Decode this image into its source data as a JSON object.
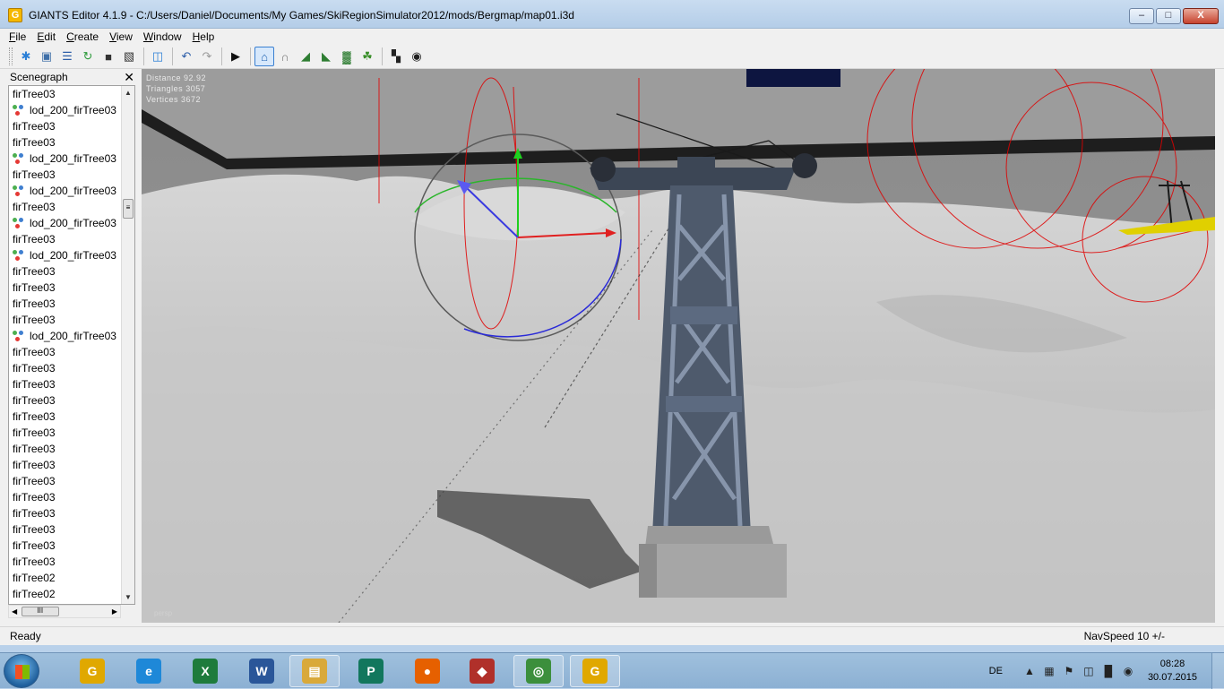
{
  "window": {
    "title": "GIANTS Editor 4.1.9 - C:/Users/Daniel/Documents/My Games/SkiRegionSimulator2012/mods/Bergmap/map01.i3d",
    "app_icon_glyph": "G",
    "controls": {
      "minimize": "–",
      "maximize": "□",
      "close": "X"
    }
  },
  "menu": [
    "File",
    "Edit",
    "Create",
    "View",
    "Window",
    "Help"
  ],
  "toolbar": {
    "buttons": [
      {
        "name": "new-icon",
        "glyph": "✱",
        "color": "#2a7fd6"
      },
      {
        "name": "open-icon",
        "glyph": "▣",
        "color": "#3f6fa8"
      },
      {
        "name": "import-icon",
        "glyph": "☰",
        "color": "#2d5ea8"
      },
      {
        "name": "reload-icon",
        "glyph": "↻",
        "color": "#2c9a3a"
      },
      {
        "name": "save-icon",
        "glyph": "■",
        "color": "#333333"
      },
      {
        "name": "save-as-icon",
        "glyph": "▧",
        "color": "#333333"
      },
      {
        "name": "sep"
      },
      {
        "name": "export-icon",
        "glyph": "◫",
        "color": "#2a7fd6"
      },
      {
        "name": "sep"
      },
      {
        "name": "undo-icon",
        "glyph": "↶",
        "color": "#2d5ea8"
      },
      {
        "name": "redo-icon",
        "glyph": "↷",
        "color": "#9a9a9a"
      },
      {
        "name": "sep"
      },
      {
        "name": "play-icon",
        "glyph": "▶",
        "color": "#111111"
      },
      {
        "name": "sep"
      },
      {
        "name": "home-icon",
        "glyph": "⌂",
        "color": "#1c5fb0",
        "active": true
      },
      {
        "name": "magnet-icon",
        "glyph": "∩",
        "color": "#777777"
      },
      {
        "name": "terrain-raise-icon",
        "glyph": "◢",
        "color": "#2e7d32"
      },
      {
        "name": "terrain-smooth-icon",
        "glyph": "◣",
        "color": "#2e7d32"
      },
      {
        "name": "terrain-paint-icon",
        "glyph": "▓",
        "color": "#2e7d32"
      },
      {
        "name": "foliage-icon",
        "glyph": "☘",
        "color": "#3a8f2a"
      },
      {
        "name": "sep"
      },
      {
        "name": "checker-icon",
        "glyph": "▚",
        "color": "#222222"
      },
      {
        "name": "render-icon",
        "glyph": "◉",
        "color": "#222222"
      }
    ]
  },
  "scenegraph": {
    "title": "Scenegraph",
    "close_glyph": "✕",
    "items": [
      {
        "label": "firTree03",
        "lod": false
      },
      {
        "label": "lod_200_firTree03",
        "lod": true
      },
      {
        "label": "firTree03",
        "lod": false
      },
      {
        "label": "firTree03",
        "lod": false
      },
      {
        "label": "lod_200_firTree03",
        "lod": true
      },
      {
        "label": "firTree03",
        "lod": false
      },
      {
        "label": "lod_200_firTree03",
        "lod": true
      },
      {
        "label": "firTree03",
        "lod": false
      },
      {
        "label": "lod_200_firTree03",
        "lod": true
      },
      {
        "label": "firTree03",
        "lod": false
      },
      {
        "label": "lod_200_firTree03",
        "lod": true
      },
      {
        "label": "firTree03",
        "lod": false
      },
      {
        "label": "firTree03",
        "lod": false
      },
      {
        "label": "firTree03",
        "lod": false
      },
      {
        "label": "firTree03",
        "lod": false
      },
      {
        "label": "lod_200_firTree03",
        "lod": true
      },
      {
        "label": "firTree03",
        "lod": false
      },
      {
        "label": "firTree03",
        "lod": false
      },
      {
        "label": "firTree03",
        "lod": false
      },
      {
        "label": "firTree03",
        "lod": false
      },
      {
        "label": "firTree03",
        "lod": false
      },
      {
        "label": "firTree03",
        "lod": false
      },
      {
        "label": "firTree03",
        "lod": false
      },
      {
        "label": "firTree03",
        "lod": false
      },
      {
        "label": "firTree03",
        "lod": false
      },
      {
        "label": "firTree03",
        "lod": false
      },
      {
        "label": "firTree03",
        "lod": false
      },
      {
        "label": "firTree03",
        "lod": false
      },
      {
        "label": "firTree03",
        "lod": false
      },
      {
        "label": "firTree03",
        "lod": false
      },
      {
        "label": "firTree02",
        "lod": false
      },
      {
        "label": "firTree02",
        "lod": false
      }
    ],
    "scroll": {
      "up": "▲",
      "down": "▼",
      "left": "◀",
      "right": "▶",
      "thumb": "≡",
      "hthumb": "III"
    }
  },
  "viewport": {
    "stats": [
      {
        "label": "Distance",
        "value": "92.92"
      },
      {
        "label": "Triangles",
        "value": "3057"
      },
      {
        "label": "Vertices",
        "value": "3672"
      }
    ],
    "camera": "persp"
  },
  "status": {
    "text": "Ready",
    "navspeed": "NavSpeed 10 +/-"
  },
  "taskbar": {
    "apps": [
      {
        "name": "taskbar-giants-icon",
        "glyph": "G",
        "color": "#e0a800",
        "open": false
      },
      {
        "name": "taskbar-ie-icon",
        "glyph": "e",
        "color": "#1e88d8",
        "open": false
      },
      {
        "name": "taskbar-excel-icon",
        "glyph": "X",
        "color": "#1e7b3c",
        "open": false
      },
      {
        "name": "taskbar-word-icon",
        "glyph": "W",
        "color": "#2a5699",
        "open": false
      },
      {
        "name": "taskbar-explorer-icon",
        "glyph": "▤",
        "color": "#d9a93a",
        "open": true
      },
      {
        "name": "taskbar-publisher-icon",
        "glyph": "P",
        "color": "#12775d",
        "open": false
      },
      {
        "name": "taskbar-firefox-icon",
        "glyph": "●",
        "color": "#e66000",
        "open": false
      },
      {
        "name": "taskbar-game-icon",
        "glyph": "◆",
        "color": "#b0302a",
        "open": false
      },
      {
        "name": "taskbar-chrome-icon",
        "glyph": "◎",
        "color": "#3c8f3c",
        "open": true
      },
      {
        "name": "taskbar-giants-editor-icon",
        "glyph": "G",
        "color": "#e0a800",
        "open": true
      }
    ],
    "lang": "DE",
    "time": "08:28",
    "date": "30.07.2015"
  }
}
